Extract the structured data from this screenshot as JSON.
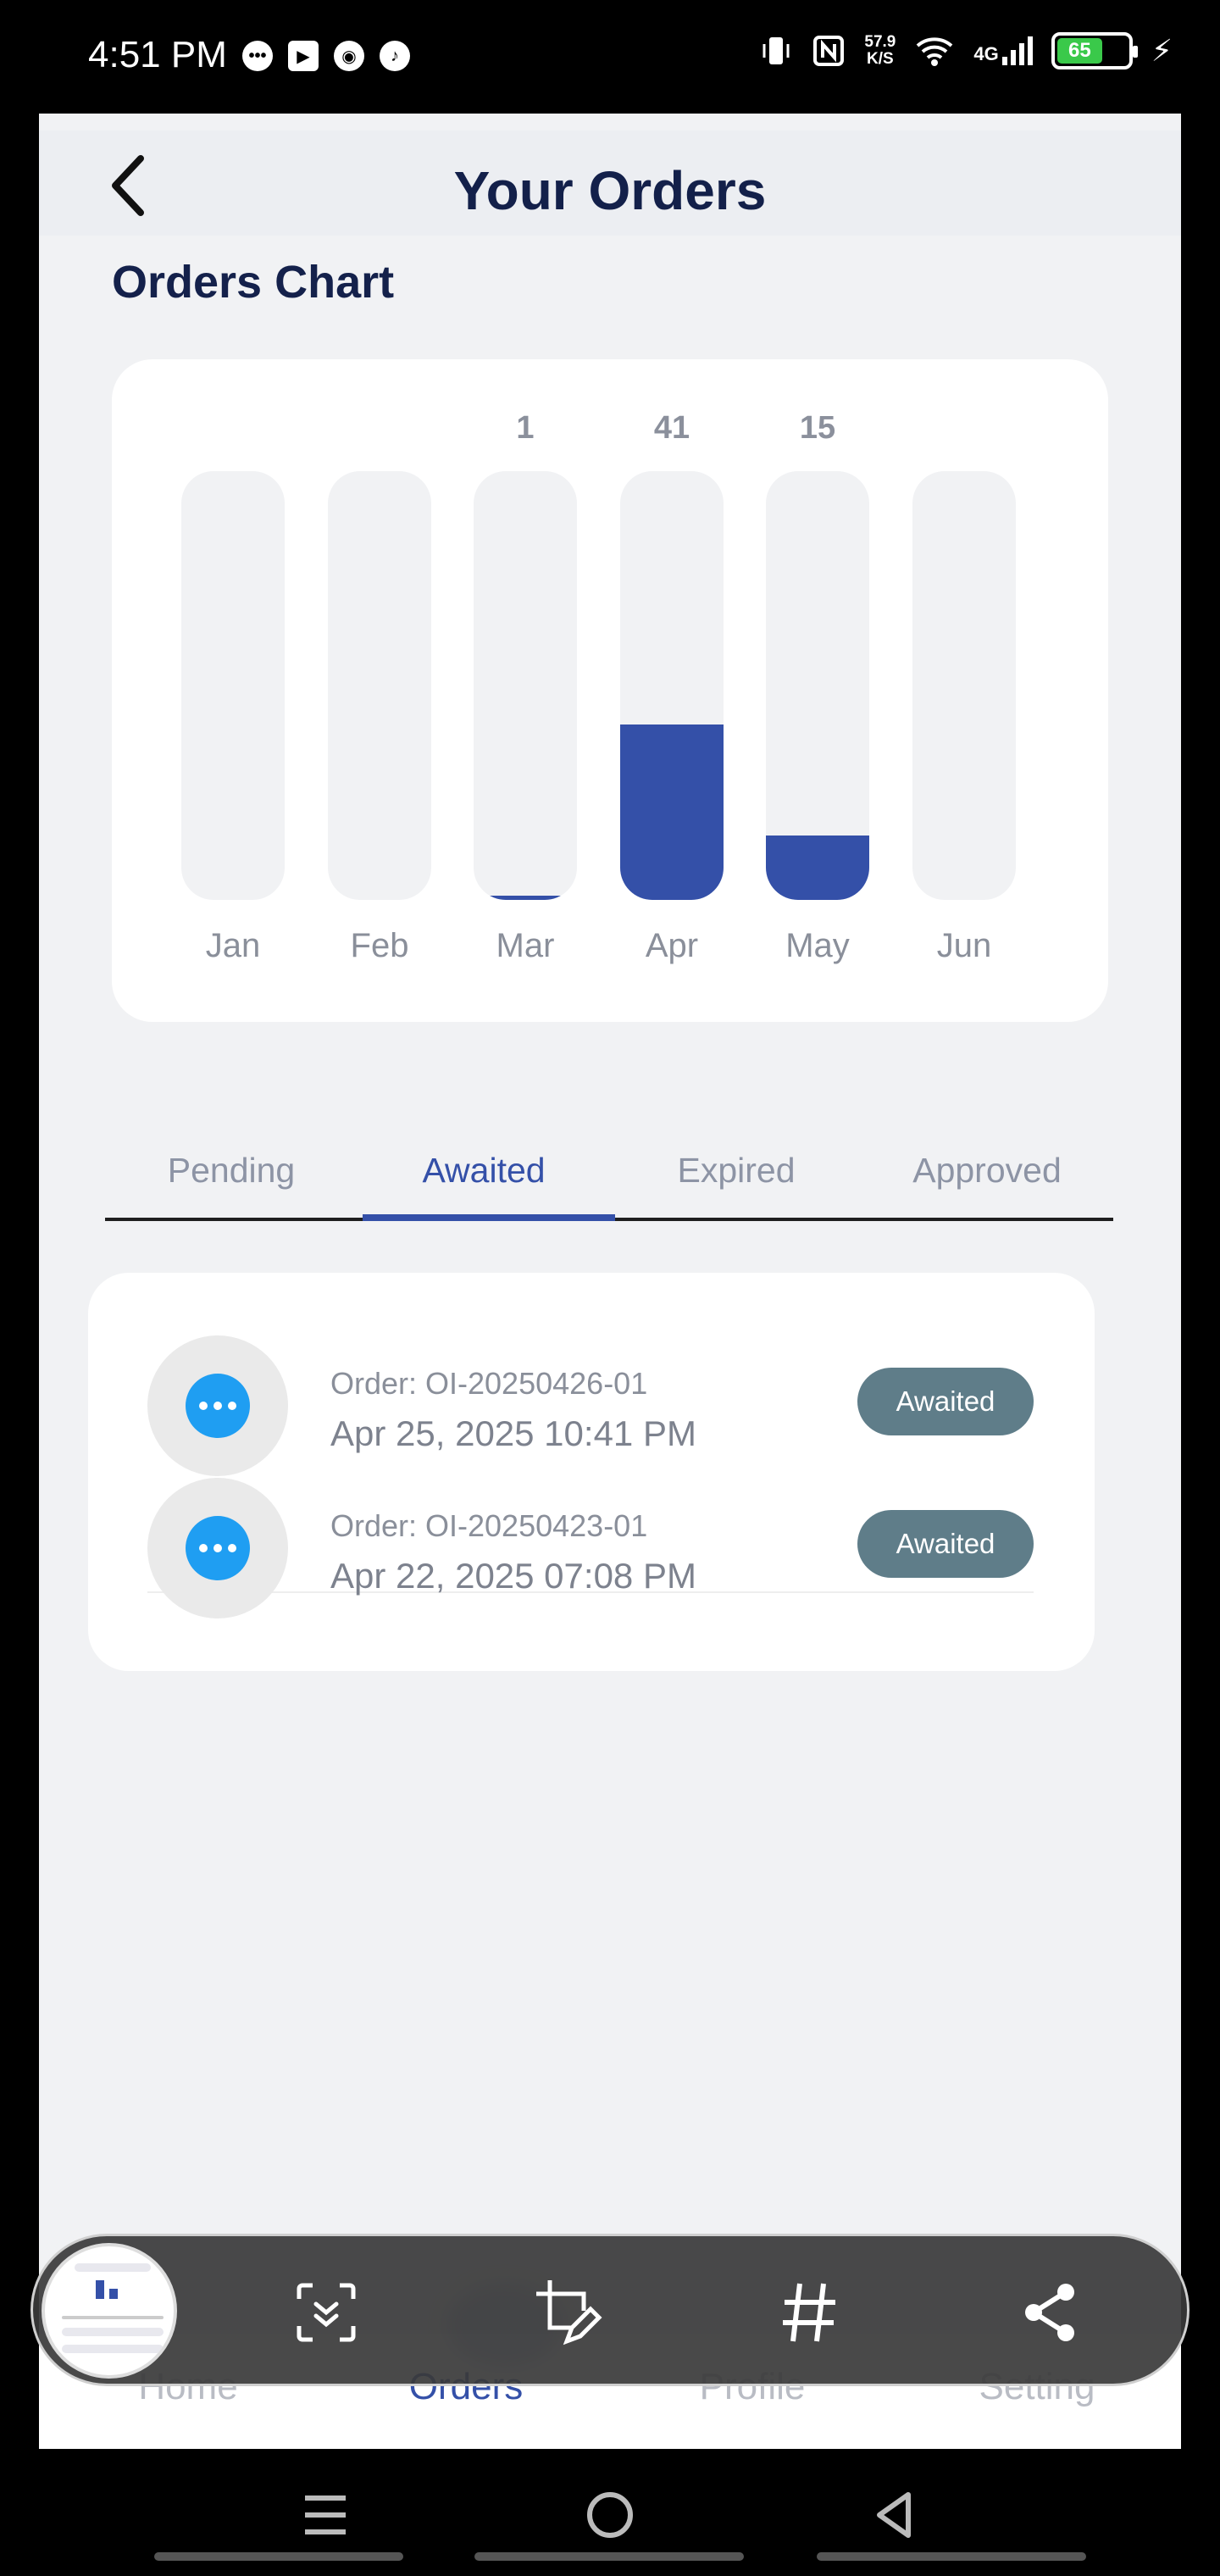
{
  "status_bar": {
    "time": "4:51 PM",
    "net_speed_value": "57.9",
    "net_speed_unit": "K/S",
    "network_type": "4G",
    "battery_level": "65"
  },
  "header": {
    "title": "Your Orders",
    "back_icon": "chevron-left-icon"
  },
  "section_title": "Orders Chart",
  "chart_data": {
    "type": "bar",
    "categories": [
      "Jan",
      "Feb",
      "Mar",
      "Apr",
      "May",
      "Jun"
    ],
    "values": [
      0,
      0,
      1,
      41,
      15,
      0
    ],
    "value_labels": [
      "",
      "",
      "1",
      "41",
      "15",
      ""
    ],
    "ylim": [
      0,
      100
    ],
    "bar_color": "#3450a8",
    "track_color": "#f1f2f4"
  },
  "tabs": [
    {
      "label": "Pending",
      "active": false
    },
    {
      "label": "Awaited",
      "active": true
    },
    {
      "label": "Expired",
      "active": false
    },
    {
      "label": "Approved",
      "active": false
    }
  ],
  "orders": [
    {
      "id": "Order: OI-20250426-01",
      "date": "Apr 25, 2025 10:41 PM",
      "status": "Awaited"
    },
    {
      "id": "Order: OI-20250423-01",
      "date": "Apr 22, 2025 07:08 PM",
      "status": "Awaited"
    }
  ],
  "bottom_nav": [
    {
      "label": "Home",
      "active": false
    },
    {
      "label": "Orders",
      "active": true
    },
    {
      "label": "Profile",
      "active": false
    },
    {
      "label": "Setting",
      "active": false
    }
  ],
  "screenshot_toolbar": {
    "tools": [
      "scroll-capture-icon",
      "crop-edit-icon",
      "hashtag-icon",
      "share-icon"
    ]
  },
  "colors": {
    "accent": "#3450a8",
    "status_badge": "#5f7d89",
    "order_icon": "#1f9ef2",
    "title_dark": "#13204a"
  }
}
